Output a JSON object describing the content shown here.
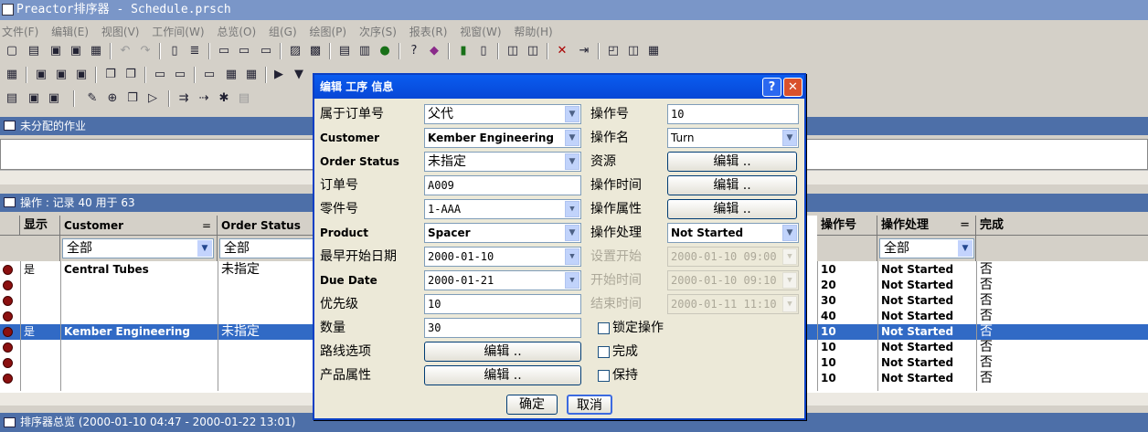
{
  "window": {
    "title": "Preactor排序器 - Schedule.prsch"
  },
  "menu": [
    "文件(F)",
    "编辑(E)",
    "视图(V)",
    "工作间(W)",
    "总览(O)",
    "组(G)",
    "绘图(P)",
    "次序(S)",
    "报表(R)",
    "视窗(W)",
    "帮助(H)"
  ],
  "unassigned_panel": {
    "title": "未分配的作业"
  },
  "ops_panel": {
    "title": "操作 : 记录 40 用于 63"
  },
  "grid": {
    "headers": {
      "show": "显示",
      "customer": "Customer",
      "order_status": "Order Status",
      "op_no": "操作号",
      "op_handling": "操作处理",
      "done": "完成",
      "eq": "="
    },
    "filters": {
      "all": "全部"
    },
    "rows": [
      {
        "show": "是",
        "customer": "Central Tubes",
        "order_status": "未指定",
        "op_no": "10",
        "handling": "Not Started",
        "done": "否",
        "selected": false
      },
      {
        "show": "",
        "customer": "",
        "order_status": "",
        "op_no": "20",
        "handling": "Not Started",
        "done": "否",
        "selected": false
      },
      {
        "show": "",
        "customer": "",
        "order_status": "",
        "op_no": "30",
        "handling": "Not Started",
        "done": "否",
        "selected": false
      },
      {
        "show": "",
        "customer": "",
        "order_status": "",
        "op_no": "40",
        "handling": "Not Started",
        "done": "否",
        "selected": false
      },
      {
        "show": "是",
        "customer": "Kember Engineering",
        "order_status": "未指定",
        "op_no": "10",
        "handling": "Not Started",
        "done": "否",
        "selected": true
      },
      {
        "show": "",
        "customer": "",
        "order_status": "",
        "op_no": "10",
        "handling": "Not Started",
        "done": "否",
        "selected": false
      },
      {
        "show": "",
        "customer": "",
        "order_status": "",
        "op_no": "10",
        "handling": "Not Started",
        "done": "否",
        "selected": false
      },
      {
        "show": "",
        "customer": "",
        "order_status": "",
        "op_no": "10",
        "handling": "Not Started",
        "done": "否",
        "selected": false
      }
    ]
  },
  "statusbar": {
    "text": "排序器总览   (2000-01-10 04:47 - 2000-01-22 13:01)"
  },
  "dialog": {
    "title": "编辑 工序 信息",
    "help_label": "?",
    "close_label": "✕",
    "left": {
      "order_belong_label": "属于订单号",
      "order_belong_value": "父代",
      "customer_label": "Customer",
      "customer_value": "Kember Engineering",
      "order_status_label": "Order Status",
      "order_status_value": "未指定",
      "order_no_label": "订单号",
      "order_no_value": "A009",
      "part_no_label": "零件号",
      "part_no_value": "1-AAA",
      "product_label": "Product",
      "product_value": "Spacer",
      "earliest_start_label": "最早开始日期",
      "earliest_start_value": "2000-01-10",
      "due_date_label": "Due Date",
      "due_date_value": "2000-01-21",
      "priority_label": "优先级",
      "priority_value": "10",
      "quantity_label": "数量",
      "quantity_value": "30",
      "route_label": "路线选项",
      "route_button": "编辑 ..",
      "product_attr_label": "产品属性",
      "product_attr_button": "编辑 .."
    },
    "right": {
      "op_no_label": "操作号",
      "op_no_value": "10",
      "op_name_label": "操作名",
      "op_name_value": "Turn",
      "resource_label": "资源",
      "resource_button": "编辑 ..",
      "op_time_label": "操作时间",
      "op_time_button": "编辑 ..",
      "op_attr_label": "操作属性",
      "op_attr_button": "编辑 ..",
      "op_handling_label": "操作处理",
      "op_handling_value": "Not Started",
      "set_start_label": "设置开始",
      "set_start_value": "2000-01-10 09:00",
      "start_time_label": "开始时间",
      "start_time_value": "2000-01-10 09:10",
      "end_time_label": "结束时间",
      "end_time_value": "2000-01-11 11:10",
      "lock_label": "锁定操作",
      "complete_label": "完成",
      "keep_label": "保持"
    },
    "ok_button": "确定",
    "cancel_button": "取消"
  }
}
